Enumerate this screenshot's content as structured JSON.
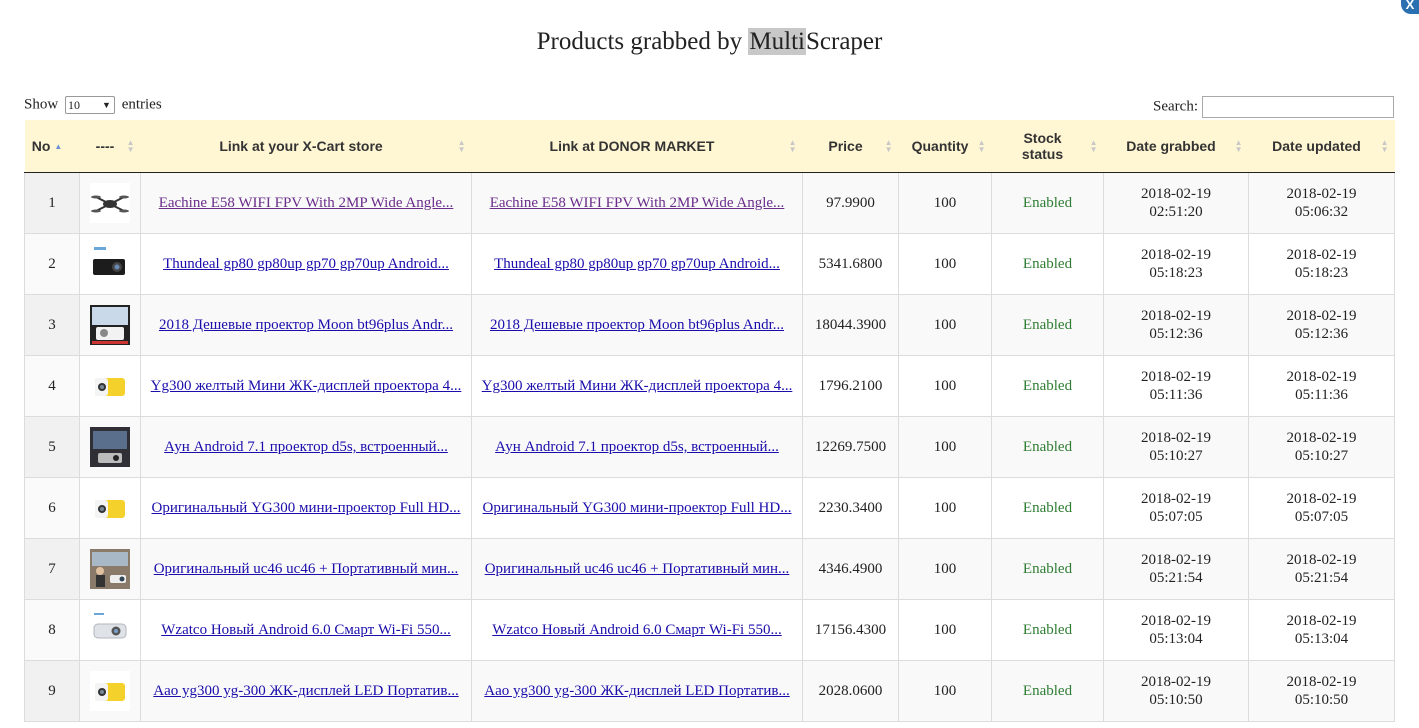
{
  "title": {
    "before": "Products grabbed by ",
    "highlight": "Multi",
    "after": "Scraper"
  },
  "close_label": "X",
  "show": {
    "prefix": "Show",
    "value": "10",
    "suffix": "entries"
  },
  "search": {
    "label": "Search:",
    "value": ""
  },
  "columns": [
    "No",
    "----",
    "Link at your X-Cart store",
    "Link at DONOR MARKET",
    "Price",
    "Quantity",
    "Stock status",
    "Date grabbed",
    "Date updated"
  ],
  "rows": [
    {
      "no": "1",
      "thumb": "drone",
      "store_link": "Eachine E58 WIFI FPV With 2MP Wide Angle...",
      "donor_link": "Eachine E58 WIFI FPV With 2MP Wide Angle...",
      "price": "97.9900",
      "qty": "100",
      "status": "Enabled",
      "grabbed_date": "2018-02-19",
      "grabbed_time": "02:51:20",
      "updated_date": "2018-02-19",
      "updated_time": "05:06:32"
    },
    {
      "no": "2",
      "thumb": "projector-black",
      "store_link": "Thundeal gp80 gp80up gp70 gp70up Android...",
      "donor_link": "Thundeal gp80 gp80up gp70 gp70up Android...",
      "price": "5341.6800",
      "qty": "100",
      "status": "Enabled",
      "grabbed_date": "2018-02-19",
      "grabbed_time": "05:18:23",
      "updated_date": "2018-02-19",
      "updated_time": "05:18:23"
    },
    {
      "no": "3",
      "thumb": "projector-white",
      "store_link": "2018 Дешевые проектор Moon bt96plus Andr...",
      "donor_link": "2018 Дешевые проектор Moon bt96plus Andr...",
      "price": "18044.3900",
      "qty": "100",
      "status": "Enabled",
      "grabbed_date": "2018-02-19",
      "grabbed_time": "05:12:36",
      "updated_date": "2018-02-19",
      "updated_time": "05:12:36"
    },
    {
      "no": "4",
      "thumb": "projector-yellow",
      "store_link": "Yg300 желтый Мини ЖК-дисплей проектора 4...",
      "donor_link": "Yg300 желтый Мини ЖК-дисплей проектора 4...",
      "price": "1796.2100",
      "qty": "100",
      "status": "Enabled",
      "grabbed_date": "2018-02-19",
      "grabbed_time": "05:11:36",
      "updated_date": "2018-02-19",
      "updated_time": "05:11:36"
    },
    {
      "no": "5",
      "thumb": "projector-scene",
      "store_link": "Аун Android 7.1 проектор d5s, встроенный...",
      "donor_link": "Аун Android 7.1 проектор d5s, встроенный...",
      "price": "12269.7500",
      "qty": "100",
      "status": "Enabled",
      "grabbed_date": "2018-02-19",
      "grabbed_time": "05:10:27",
      "updated_date": "2018-02-19",
      "updated_time": "05:10:27"
    },
    {
      "no": "6",
      "thumb": "projector-yellow",
      "store_link": "Оригинальный YG300 мини-проектор Full HD...",
      "donor_link": "Оригинальный YG300 мини-проектор Full HD...",
      "price": "2230.3400",
      "qty": "100",
      "status": "Enabled",
      "grabbed_date": "2018-02-19",
      "grabbed_time": "05:07:05",
      "updated_date": "2018-02-19",
      "updated_time": "05:07:05"
    },
    {
      "no": "7",
      "thumb": "projector-people",
      "store_link": "Оригинальный uc46 uc46 + Портативный мин...",
      "donor_link": "Оригинальный uc46 uc46 + Портативный мин...",
      "price": "4346.4900",
      "qty": "100",
      "status": "Enabled",
      "grabbed_date": "2018-02-19",
      "grabbed_time": "05:21:54",
      "updated_date": "2018-02-19",
      "updated_time": "05:21:54"
    },
    {
      "no": "8",
      "thumb": "projector-silver",
      "store_link": "Wzatco Новый Android 6.0 Смарт Wi-Fi 550...",
      "donor_link": "Wzatco Новый Android 6.0 Смарт Wi-Fi 550...",
      "price": "17156.4300",
      "qty": "100",
      "status": "Enabled",
      "grabbed_date": "2018-02-19",
      "grabbed_time": "05:13:04",
      "updated_date": "2018-02-19",
      "updated_time": "05:13:04"
    },
    {
      "no": "9",
      "thumb": "projector-yellow",
      "store_link": "Aao yg300 yg-300 ЖК-дисплей LED Портатив...",
      "donor_link": "Aao yg300 yg-300 ЖК-дисплей LED Портатив...",
      "price": "2028.0600",
      "qty": "100",
      "status": "Enabled",
      "grabbed_date": "2018-02-19",
      "grabbed_time": "05:10:50",
      "updated_date": "2018-02-19",
      "updated_time": "05:10:50"
    }
  ]
}
